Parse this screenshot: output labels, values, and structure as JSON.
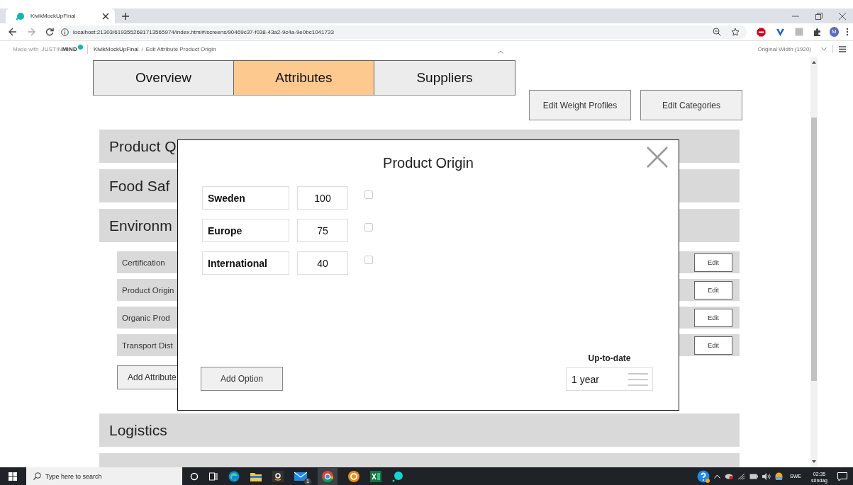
{
  "browser": {
    "tab_title": "KivikMockUpFinal",
    "url": "localhost:21303/6193552681713565974/index.html#/screens/90469c37-f038-43a2-9c4a-9e0bc1041733",
    "profile_initial": "M"
  },
  "prototype_bar": {
    "made_with": "Made with",
    "brand": "JUSTIN**MIND**",
    "project": "KivikMockUpFinal",
    "separator": "/",
    "screen": "Edit Attribute Product Origin",
    "width_selector": "Original Width (1920)"
  },
  "tabs": [
    {
      "label": "Overview",
      "selected": false
    },
    {
      "label": "Attributes",
      "selected": true
    },
    {
      "label": "Suppliers",
      "selected": false
    }
  ],
  "top_buttons": [
    "Edit Weight Profiles",
    "Edit Categories"
  ],
  "sections": [
    {
      "title": "Product Q"
    },
    {
      "title": "Food Saf"
    },
    {
      "title": "Environm"
    }
  ],
  "attributes": [
    {
      "name": "Certification",
      "button": "Edit"
    },
    {
      "name": "Product Origin",
      "button": "Edit"
    },
    {
      "name": "Organic Prod",
      "button": "Edit"
    },
    {
      "name": "Transport Dist",
      "button": "Edit"
    }
  ],
  "add_attribute": "Add Attribute",
  "lower_sections": [
    {
      "title": "Logistics"
    }
  ],
  "dialog": {
    "title": "Product Origin",
    "options": [
      {
        "name": "Sweden",
        "value": "100",
        "checked": false
      },
      {
        "name": "Europe",
        "value": "75",
        "checked": false
      },
      {
        "name": "International",
        "value": "40",
        "checked": false
      }
    ],
    "add_option": "Add Option",
    "up_to_date_label": "Up-to-date",
    "up_to_date_value": "1 year"
  },
  "taskbar": {
    "search_placeholder": "Type here to search",
    "mail_badge": "1",
    "language": "SWE",
    "time": "02:35",
    "day": "söndag"
  }
}
